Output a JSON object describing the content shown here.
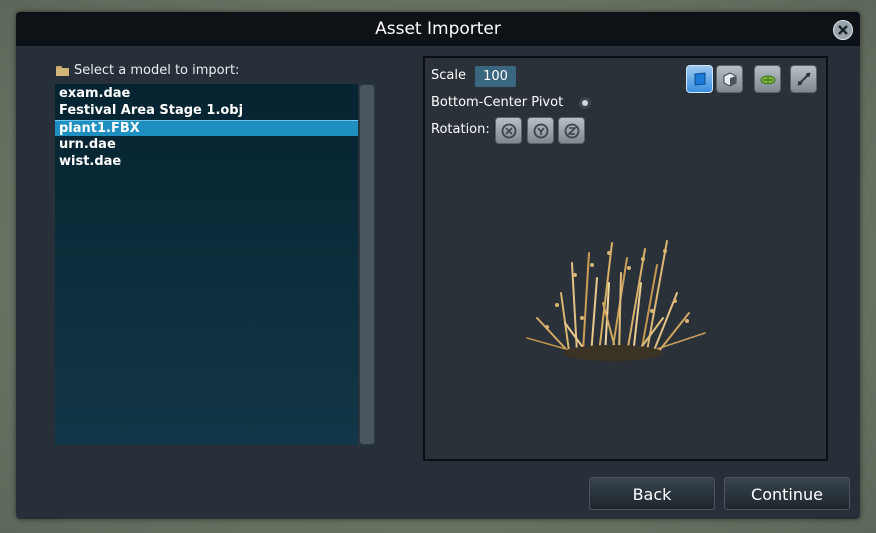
{
  "window": {
    "title": "Asset Importer"
  },
  "file_panel": {
    "label": "Select a model to import:",
    "files": [
      "exam.dae",
      "Festival Area Stage 1.obj",
      "plant1.FBX",
      "urn.dae",
      "wist.dae"
    ],
    "selected_file": "plant1.FBX"
  },
  "preview": {
    "scale_label": "Scale",
    "scale_value": "100",
    "pivot_label": "Bottom-Center Pivot",
    "rotation_label": "Rotation:",
    "rotation_buttons": [
      "rotate-x-icon",
      "rotate-y-icon",
      "rotate-z-icon"
    ],
    "view_buttons": [
      "mesh-view-icon",
      "lod-view-icon",
      "texture-view-icon",
      "wireframe-view-icon"
    ],
    "active_view": "mesh-view-icon"
  },
  "footer": {
    "back_label": "Back",
    "continue_label": "Continue"
  },
  "colors": {
    "accent": "#1f8fc0",
    "title_bar": "#0c1216",
    "panel_bg": "#273039"
  }
}
